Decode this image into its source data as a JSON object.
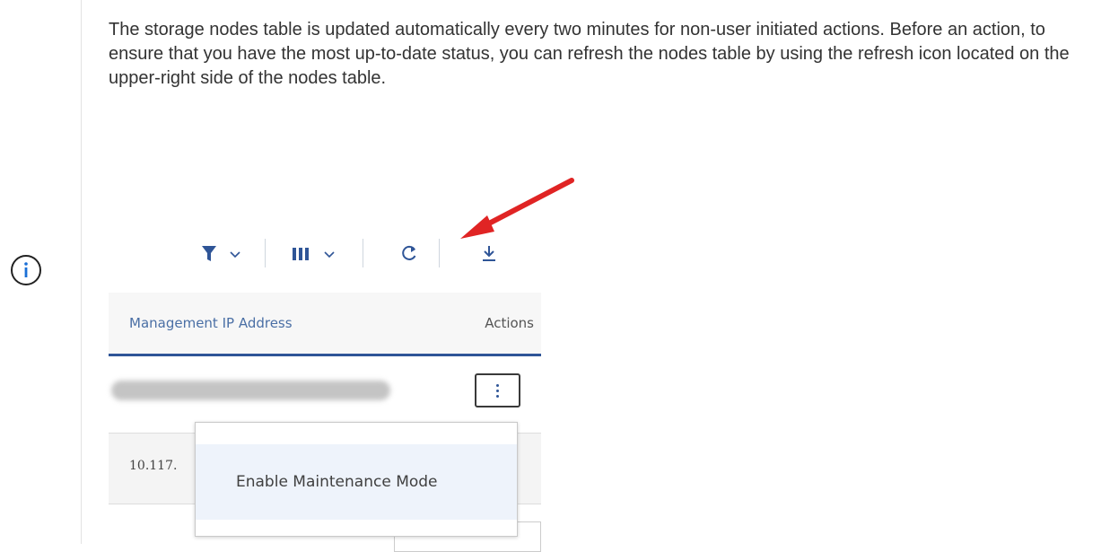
{
  "note": {
    "text": "The storage nodes table is updated automatically every two minutes for non-user initiated actions. Before an action, to ensure that you have the most up-to-date status, you can refresh the nodes table by using the refresh icon located on the upper-right side of the nodes table."
  },
  "table": {
    "toolbar_icons": [
      "filter-icon",
      "chevron-down-icon",
      "columns-icon",
      "chevron-down-icon",
      "refresh-icon",
      "download-icon"
    ],
    "headers": {
      "management_ip": "Management IP Address",
      "actions": "Actions"
    },
    "rows": [
      {
        "ip": "10.117."
      }
    ]
  },
  "menu": {
    "items": [
      "Enable Maintenance Mode"
    ]
  },
  "colors": {
    "accent": "#2f5597",
    "toolbar_icon": "#2f5597",
    "annotation_arrow": "#e02424"
  }
}
